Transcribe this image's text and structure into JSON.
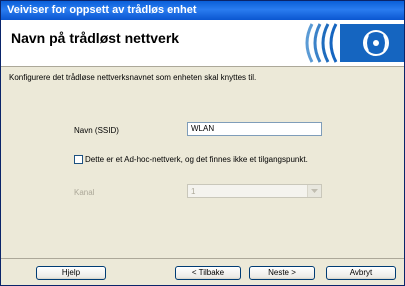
{
  "window": {
    "title": "Veiviser for oppsett av trådløs enhet"
  },
  "header": {
    "title": "Navn på trådløst nettverk",
    "logo_icon": "wireless-signal-icon"
  },
  "main": {
    "description": "Konfigurere det trådløse nettverksnavnet som enheten skal knyttes til.",
    "ssid_label": "Navn (SSID)",
    "ssid_value": "WLAN",
    "adhoc_label": "Dette er et Ad-hoc-nettverk, og det finnes ikke et tilgangspunkt.",
    "adhoc_checked": false,
    "channel_label": "Kanal",
    "channel_value": "1"
  },
  "footer": {
    "help": "Hjelp",
    "back": "< Tilbake",
    "next": "Neste >",
    "cancel": "Avbryt"
  },
  "colors": {
    "titlebar": "#0a5fd8",
    "logo_blue": "#1565c0",
    "dialog_bg": "#ece9d8"
  }
}
